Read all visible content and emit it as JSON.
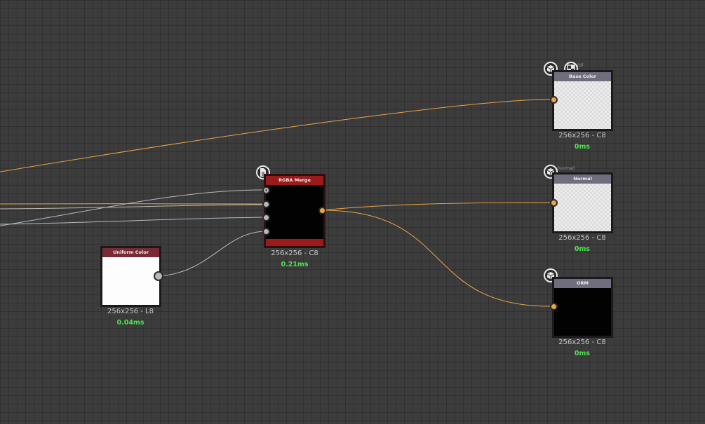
{
  "colors": {
    "wire_orange": "#e8a548",
    "wire_gray": "#b9b9b9",
    "header_uniform": "#7a2a34",
    "header_merge": "#9b1b1b",
    "header_output": "#6e6e7e",
    "timing_green": "#4ee04e"
  },
  "nodes": {
    "uniform_color": {
      "title": "Uniform Color",
      "size": "256x256 - L8",
      "time": "0.04ms",
      "preview": "white"
    },
    "rgba_merge": {
      "title": "RGBA Merge",
      "size": "256x256 - C8",
      "time": "0.21ms",
      "preview": "black",
      "badge_icon": "document-icon"
    },
    "base_color": {
      "title": "Base Color",
      "size": "256x256 - C8",
      "time": "0ms",
      "preview": "checker",
      "tag": "(d)",
      "badge_icons": [
        "cube-icon",
        "image-icon"
      ]
    },
    "normal": {
      "title": "Normal",
      "size": "256x256 - C8",
      "time": "0ms",
      "preview": "checker",
      "tag": "(normal)",
      "badge_icons": [
        "cube-icon"
      ]
    },
    "orm": {
      "title": "ORM",
      "size": "256x256 - C8",
      "time": "0ms",
      "preview": "black",
      "badge_icons": [
        "cube-icon"
      ]
    }
  }
}
